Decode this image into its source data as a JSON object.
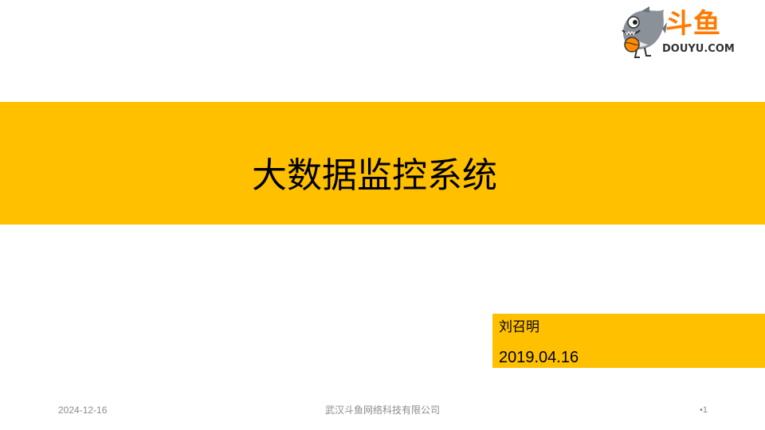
{
  "logo": {
    "icon": "shark-mascot-icon",
    "name_cn": "斗鱼",
    "name_en": "DOUYU.COM",
    "brand_color": "#ff7a00"
  },
  "slide": {
    "title": "大数据监控系统",
    "author": "刘召明",
    "date": "2019.04.16",
    "accent_color": "#ffc000"
  },
  "footer": {
    "date": "2024-12-16",
    "company": "武汉斗鱼网络科技有限公司",
    "page": "•1"
  }
}
